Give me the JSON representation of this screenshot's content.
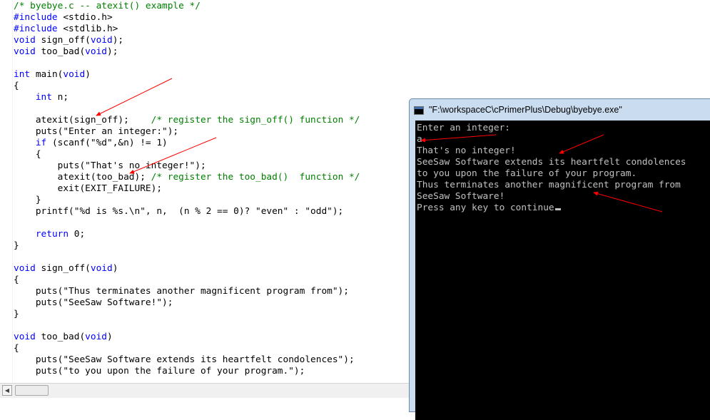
{
  "editor": {
    "lines": [
      [
        {
          "t": "/* byebye.c -- atexit() example */",
          "c": "cm"
        }
      ],
      [
        {
          "t": "#include",
          "c": "kw"
        },
        {
          "t": " <stdio.h>"
        }
      ],
      [
        {
          "t": "#include",
          "c": "kw"
        },
        {
          "t": " <stdlib.h>"
        }
      ],
      [
        {
          "t": "void",
          "c": "kw"
        },
        {
          "t": " sign_off("
        },
        {
          "t": "void",
          "c": "kw"
        },
        {
          "t": ");"
        }
      ],
      [
        {
          "t": "void",
          "c": "kw"
        },
        {
          "t": " too_bad("
        },
        {
          "t": "void",
          "c": "kw"
        },
        {
          "t": ");"
        }
      ],
      [],
      [
        {
          "t": "int",
          "c": "kw"
        },
        {
          "t": " main("
        },
        {
          "t": "void",
          "c": "kw"
        },
        {
          "t": ")"
        }
      ],
      [
        {
          "t": "{"
        }
      ],
      [
        {
          "t": "    "
        },
        {
          "t": "int",
          "c": "kw"
        },
        {
          "t": " n;"
        }
      ],
      [],
      [
        {
          "t": "    atexit(sign_off);    "
        },
        {
          "t": "/* register the sign_off() function */",
          "c": "cm"
        }
      ],
      [
        {
          "t": "    puts(\"Enter an integer:\");"
        }
      ],
      [
        {
          "t": "    "
        },
        {
          "t": "if",
          "c": "kw"
        },
        {
          "t": " (scanf(\"%d\",&n) != 1)"
        }
      ],
      [
        {
          "t": "    {"
        }
      ],
      [
        {
          "t": "        puts(\"That's no integer!\");"
        }
      ],
      [
        {
          "t": "        atexit(too_bad); "
        },
        {
          "t": "/* register the too_bad()  function */",
          "c": "cm"
        }
      ],
      [
        {
          "t": "        exit(EXIT_FAILURE);"
        }
      ],
      [
        {
          "t": "    }"
        }
      ],
      [
        {
          "t": "    printf(\"%d is %s.\\n\", n,  (n % 2 == 0)? \"even\" : \"odd\");"
        }
      ],
      [],
      [
        {
          "t": "    "
        },
        {
          "t": "return",
          "c": "kw"
        },
        {
          "t": " 0;"
        }
      ],
      [
        {
          "t": "}"
        }
      ],
      [],
      [
        {
          "t": "void",
          "c": "kw"
        },
        {
          "t": " sign_off("
        },
        {
          "t": "void",
          "c": "kw"
        },
        {
          "t": ")"
        }
      ],
      [
        {
          "t": "{"
        }
      ],
      [
        {
          "t": "    puts(\"Thus terminates another magnificent program from\");"
        }
      ],
      [
        {
          "t": "    puts(\"SeeSaw Software!\");"
        }
      ],
      [
        {
          "t": "}"
        }
      ],
      [],
      [
        {
          "t": "void",
          "c": "kw"
        },
        {
          "t": " too_bad("
        },
        {
          "t": "void",
          "c": "kw"
        },
        {
          "t": ")"
        }
      ],
      [
        {
          "t": "{"
        }
      ],
      [
        {
          "t": "    puts(\"SeeSaw Software extends its heartfelt condolences\");"
        }
      ],
      [
        {
          "t": "    puts(\"to you upon the failure of your program.\");"
        }
      ]
    ],
    "scroll_left_glyph": "◀"
  },
  "console": {
    "title": "\"F:\\workspaceC\\cPrimerPlus\\Debug\\byebye.exe\"",
    "lines": [
      "Enter an integer:",
      "a",
      "That's no integer!",
      "SeeSaw Software extends its heartfelt condolences",
      "to you upon the failure of your program.",
      "Thus terminates another magnificent program from",
      "SeeSaw Software!",
      "Press any key to continue"
    ]
  },
  "colors": {
    "keyword": "#0000ff",
    "comment": "#008000",
    "annotation_arrow": "#ff0000",
    "console_bg": "#000000",
    "console_text": "#c0c0c0"
  },
  "annotations": [
    "red-arrow-atexit-sign-off",
    "red-arrow-atexit-too-bad",
    "red-arrow-input",
    "red-arrow-condolences",
    "red-arrow-terminates"
  ]
}
